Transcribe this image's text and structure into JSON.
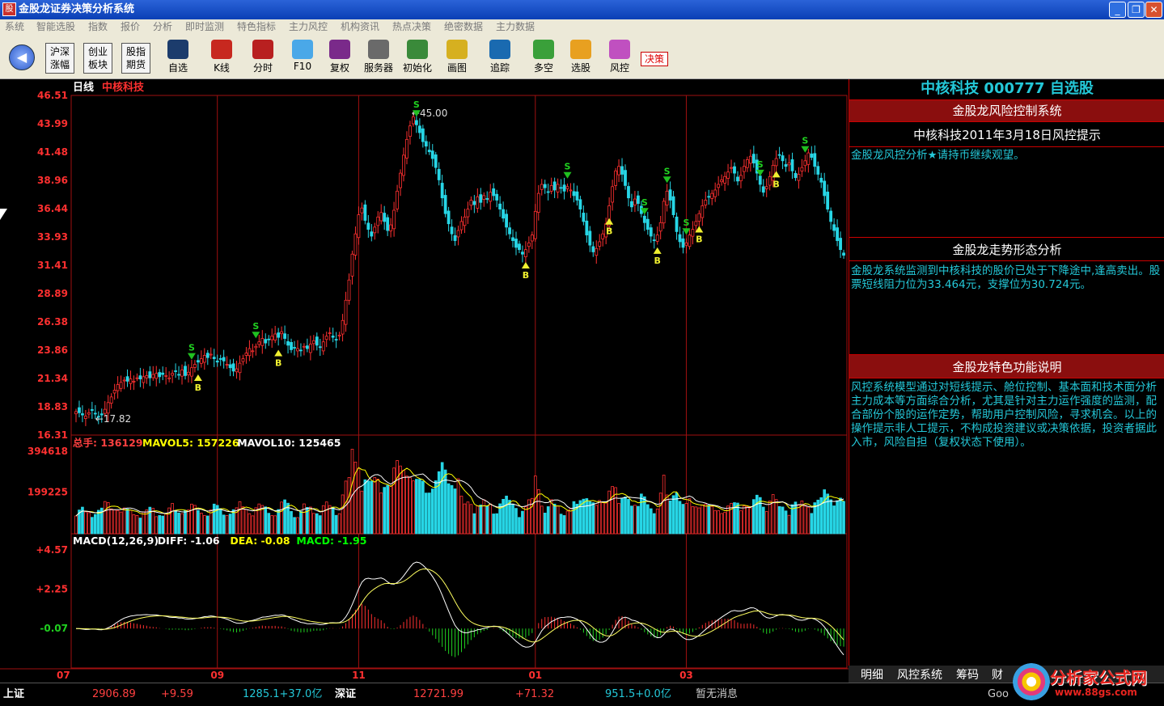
{
  "window": {
    "title": "金股龙证券决策分析系统",
    "app_icon": "股",
    "minimize": "_",
    "restore": "❐",
    "close": "✕"
  },
  "menu": [
    "系统",
    "智能选股",
    "指数",
    "报价",
    "分析",
    "即时监测",
    "特色指标",
    "主力风控",
    "机构资讯",
    "热点决策",
    "绝密数据",
    "主力数据"
  ],
  "toolbar": {
    "back": "◀",
    "buttons_text": [
      {
        "id": "hushen",
        "l1": "沪深",
        "l2": "涨幅"
      },
      {
        "id": "chuangye",
        "l1": "创业",
        "l2": "板块"
      },
      {
        "id": "guzhi",
        "l1": "股指",
        "l2": "期货"
      }
    ],
    "buttons": [
      {
        "id": "zixuan",
        "label": "自选",
        "color": "#1c3c6c"
      },
      {
        "id": "kline",
        "label": "K线",
        "color": "#c7281f"
      },
      {
        "id": "fenshi",
        "label": "分时",
        "color": "#b82020"
      },
      {
        "id": "f10",
        "label": "F10",
        "color": "#4aa8e8"
      },
      {
        "id": "fuquan",
        "label": "复权",
        "color": "#7a2a8a"
      },
      {
        "id": "fuwuqi",
        "label": "服务器",
        "color": "#6a6a6a"
      },
      {
        "id": "chushihua",
        "label": "初始化",
        "color": "#3a8a3a"
      },
      {
        "id": "huatu",
        "label": "画图",
        "color": "#d6b020"
      },
      {
        "id": "zhuizong",
        "label": "追踪",
        "color": "#1a6ab0"
      },
      {
        "id": "duokong",
        "label": "多空",
        "color": "#3aa03a"
      },
      {
        "id": "xuangu",
        "label": "选股",
        "color": "#e8a020"
      },
      {
        "id": "fengkong",
        "label": "风控",
        "color": "#c050c0"
      }
    ],
    "decide": "决策"
  },
  "chart_data": [
    {
      "type": "candlestick",
      "title": "日线",
      "stock_name": "中核科技",
      "y_ticks": [
        "46.51",
        "43.99",
        "41.48",
        "38.96",
        "36.44",
        "33.93",
        "31.41",
        "28.89",
        "26.38",
        "23.86",
        "21.34",
        "18.83",
        "16.31"
      ],
      "ylim": [
        16.31,
        46.51
      ],
      "x_ticks": [
        "07",
        "09",
        "11",
        "01",
        "03"
      ],
      "annotations": [
        {
          "text": "45.00",
          "kind": "high"
        },
        {
          "text": "17.82",
          "kind": "low"
        }
      ],
      "close_path": [
        18.4,
        18.3,
        18.1,
        18.0,
        18.3,
        18.5,
        18.2,
        17.9,
        18.1,
        18.6,
        19.2,
        19.7,
        20.3,
        20.8,
        21.0,
        21.2,
        21.1,
        21.3,
        21.1,
        21.4,
        21.3,
        21.5,
        21.6,
        21.4,
        21.7,
        21.8,
        21.5,
        21.7,
        21.6,
        21.4,
        21.8,
        22.0,
        21.7,
        22.1,
        21.6,
        21.9,
        22.3,
        22.6,
        22.8,
        23.1,
        23.4,
        23.2,
        23.5,
        23.1,
        22.8,
        23.1,
        22.9,
        22.6,
        22.3,
        22.0,
        22.2,
        22.7,
        23.1,
        23.6,
        24.0,
        23.8,
        24.2,
        24.6,
        24.9,
        24.5,
        24.8,
        25.1,
        25.3,
        25.0,
        25.5,
        24.9,
        24.3,
        23.9,
        24.1,
        24.0,
        23.8,
        24.2,
        24.0,
        24.4,
        24.7,
        24.3,
        24.1,
        24.6,
        25.1,
        25.4,
        25.0,
        24.8,
        25.2,
        26.5,
        28.3,
        30.1,
        32.4,
        34.2,
        35.9,
        36.5,
        35.4,
        34.6,
        34.0,
        34.8,
        35.7,
        36.1,
        35.3,
        34.5,
        35.0,
        36.3,
        38.0,
        39.6,
        41.2,
        42.6,
        43.8,
        44.6,
        43.9,
        43.2,
        42.4,
        42.0,
        41.5,
        40.9,
        40.1,
        39.0,
        37.4,
        36.0,
        35.1,
        34.2,
        33.6,
        34.5,
        35.3,
        35.7,
        36.4,
        37.2,
        36.8,
        37.5,
        37.0,
        37.6,
        37.3,
        37.9,
        37.6,
        37.2,
        36.4,
        35.6,
        34.8,
        34.2,
        33.6,
        33.0,
        32.8,
        32.4,
        32.8,
        33.4,
        34.1,
        36.2,
        37.8,
        38.6,
        38.3,
        37.9,
        38.5,
        38.1,
        38.6,
        38.3,
        38.0,
        38.4,
        38.1,
        37.6,
        37.2,
        36.4,
        35.3,
        34.1,
        33.2,
        32.6,
        32.9,
        33.5,
        34.2,
        35.1,
        36.7,
        38.4,
        39.8,
        40.2,
        39.5,
        38.5,
        37.4,
        36.6,
        37.3,
        36.9,
        36.0,
        35.2,
        34.6,
        34.0,
        33.6,
        34.1,
        35.2,
        37.1,
        38.0,
        37.2,
        35.9,
        34.4,
        33.5,
        33.0,
        33.4,
        34.1,
        34.6,
        35.3,
        36.0,
        36.7,
        37.2,
        37.5,
        37.8,
        38.1,
        38.6,
        39.0,
        39.3,
        39.7,
        40.1,
        39.6,
        38.9,
        39.4,
        40.2,
        40.8,
        41.1,
        40.5,
        39.6,
        38.6,
        37.9,
        38.4,
        39.3,
        40.3,
        40.9,
        41.2,
        40.7,
        40.2,
        40.5,
        39.8,
        39.2,
        39.5,
        40.1,
        40.7,
        41.4,
        41.0,
        40.2,
        39.5,
        38.8,
        37.6,
        36.4,
        35.3,
        34.5,
        33.6,
        32.8,
        32.3
      ],
      "signals": [
        {
          "index": 36,
          "type": "S"
        },
        {
          "index": 38,
          "type": "B"
        },
        {
          "index": 56,
          "type": "S"
        },
        {
          "index": 63,
          "type": "B"
        },
        {
          "index": 106,
          "type": "S"
        },
        {
          "index": 140,
          "type": "B"
        },
        {
          "index": 153,
          "type": "S"
        },
        {
          "index": 166,
          "type": "B"
        },
        {
          "index": 177,
          "type": "S"
        },
        {
          "index": 181,
          "type": "B"
        },
        {
          "index": 184,
          "type": "S"
        },
        {
          "index": 190,
          "type": "S"
        },
        {
          "index": 194,
          "type": "B"
        },
        {
          "index": 213,
          "type": "S"
        },
        {
          "index": 218,
          "type": "B"
        },
        {
          "index": 227,
          "type": "S"
        }
      ]
    },
    {
      "type": "bar",
      "title": "总手",
      "legend": [
        {
          "name": "总手",
          "value": "136129",
          "color": "#ff4040"
        },
        {
          "name": "MAVOL5",
          "value": "157226",
          "color": "#ffff00"
        },
        {
          "name": "MAVOL10",
          "value": "125465",
          "color": "#ffffff"
        }
      ],
      "y_ticks": [
        "394618",
        "199225"
      ],
      "ylim": [
        0,
        394618
      ]
    },
    {
      "type": "bar",
      "title": "MACD(12,26,9)",
      "legend": [
        {
          "name": "MACD(12,26,9)",
          "value": "",
          "color": "#ffffff"
        },
        {
          "name": "DIFF",
          "value": "-1.06",
          "color": "#ffffff"
        },
        {
          "name": "DEA",
          "value": "-0.08",
          "color": "#ffff00"
        },
        {
          "name": "MACD",
          "value": "-1.95",
          "color": "#00ff00"
        }
      ],
      "y_ticks": [
        "+4.57",
        "+2.25",
        "-0.07"
      ],
      "ylim": [
        -2.4,
        4.57
      ]
    }
  ],
  "right_panel": {
    "stock_title": "中核科技 000777 自选股",
    "risk_header": "金股龙风险控制系统",
    "risk_sub": "中核科技2011年3月18日风控提示",
    "risk_text": "金股龙风控分析★请持币继续观望。",
    "trend_header": "金股龙走势形态分析",
    "trend_text": "金股龙系统监测到中核科技的股价已处于下降途中,逢高卖出。股票短线阻力位为33.464元，支撑位为30.724元。",
    "feature_header": "金股龙特色功能说明",
    "feature_text": "风控系统模型通过对短线提示、舱位控制、基本面和技术面分析主力成本等方面综合分析，尤其是针对主力运作强度的监测，配合部份个股的运作定势，帮助用户控制风险，寻求机会。以上的操作提示非人工提示，不构成投资建议或决策依据，投资者据此入市，风险自担（复权状态下使用）。"
  },
  "bottom_tabs": [
    "明细",
    "风控系统",
    "筹码",
    "财"
  ],
  "status": {
    "sh_label": "上证",
    "sh_index": "2906.89",
    "sh_change": "+9.59",
    "sh_volume": "1285.1+37.0亿",
    "sz_label": "深证",
    "sz_index": "12721.99",
    "sz_change": "+71.32",
    "sz_volume": "951.5+0.0亿",
    "message": "暂无消息",
    "extra": "Goo"
  },
  "watermark": {
    "text": "分析家公式网",
    "url": "www.88gs.com"
  }
}
